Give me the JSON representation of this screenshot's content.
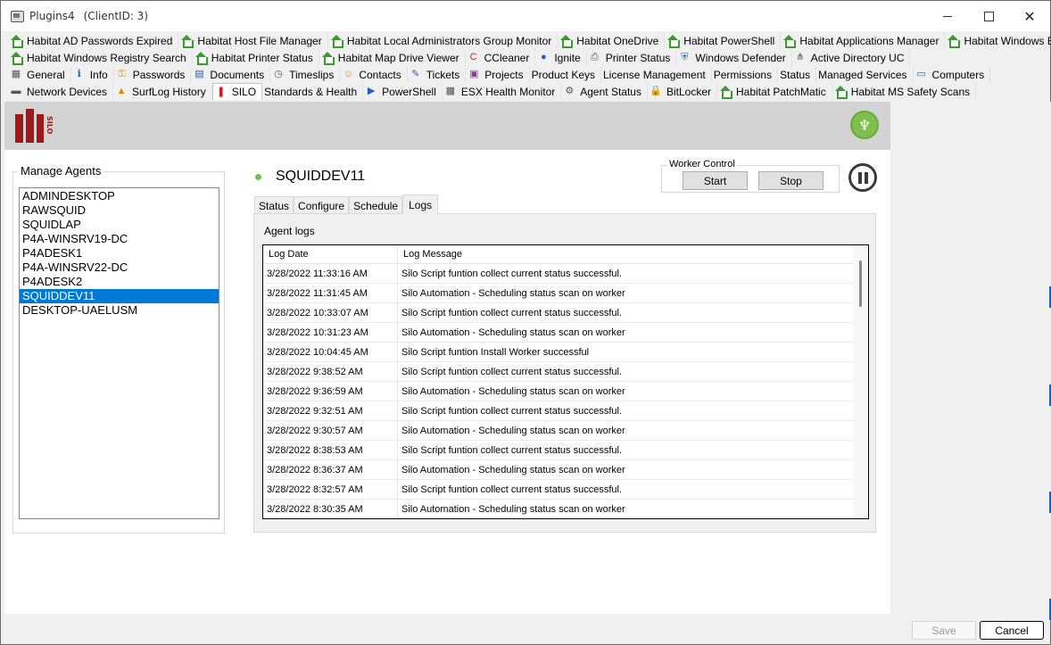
{
  "window": {
    "title": "Plugins4",
    "client": "(ClientID: 3)",
    "close_glyph": "✕"
  },
  "tabs": {
    "rows": [
      [
        {
          "label": "Habitat AD Passwords Expired",
          "icon": "house-icon"
        },
        {
          "label": "Habitat Host File Manager",
          "icon": "house-icon"
        },
        {
          "label": "Habitat Local Administrators Group Monitor",
          "icon": "house-icon"
        },
        {
          "label": "Habitat OneDrive",
          "icon": "house-icon"
        },
        {
          "label": "Habitat PowerShell",
          "icon": "house-icon"
        },
        {
          "label": "Habitat Applications Manager",
          "icon": "house-icon"
        },
        {
          "label": "Habitat Windows Backup",
          "icon": "house-icon"
        }
      ],
      [
        {
          "label": "Habitat Windows Registry Search",
          "icon": "house-icon"
        },
        {
          "label": "Habitat Printer Status",
          "icon": "house-icon"
        },
        {
          "label": "Habitat Map Drive Viewer",
          "icon": "house-icon"
        },
        {
          "label": "CCleaner",
          "icon": "ccleaner-icon"
        },
        {
          "label": "Ignite",
          "icon": "ignite-icon"
        },
        {
          "label": "Printer Status",
          "icon": "printer-icon"
        },
        {
          "label": "Windows Defender",
          "icon": "shield-icon"
        },
        {
          "label": "Active Directory UC",
          "icon": "network-tree-icon"
        }
      ],
      [
        {
          "label": "General",
          "icon": "grid-icon"
        },
        {
          "label": "Info",
          "icon": "info-icon"
        },
        {
          "label": "Passwords",
          "icon": "key-icon"
        },
        {
          "label": "Documents",
          "icon": "document-icon"
        },
        {
          "label": "Timeslips",
          "icon": "clock-icon"
        },
        {
          "label": "Contacts",
          "icon": "contacts-icon"
        },
        {
          "label": "Tickets",
          "icon": "ticket-icon"
        },
        {
          "label": "Projects",
          "icon": "projects-icon"
        },
        {
          "label": "Product Keys",
          "icon": ""
        },
        {
          "label": "License Management",
          "icon": ""
        },
        {
          "label": "Permissions",
          "icon": ""
        },
        {
          "label": "Status",
          "icon": ""
        },
        {
          "label": "Managed Services",
          "icon": ""
        },
        {
          "label": "Computers",
          "icon": "computers-icon"
        }
      ],
      [
        {
          "label": "Network Devices",
          "icon": "network-device-icon"
        },
        {
          "label": "SurfLog History",
          "icon": "cone-icon"
        },
        {
          "label": "SILO",
          "icon": "silo-icon"
        },
        {
          "label": "Standards & Health",
          "icon": ""
        },
        {
          "label": "PowerShell",
          "icon": "powershell-icon"
        },
        {
          "label": "ESX Health Monitor",
          "icon": "esx-icon"
        },
        {
          "label": "Agent Status",
          "icon": "gear-icon"
        },
        {
          "label": "BitLocker",
          "icon": "lock-icon"
        },
        {
          "label": "Habitat PatchMatic",
          "icon": "house-icon"
        },
        {
          "label": "Habitat MS Safety Scans",
          "icon": "house-icon"
        }
      ]
    ],
    "active": "SILO"
  },
  "banner": {
    "logo_text": "SILO"
  },
  "agents": {
    "legend": "Manage Agents",
    "items": [
      "ADMINDESKTOP",
      "RAWSQUID",
      "SQUIDLAP",
      "P4A-WINSRV19-DC",
      "P4ADESK1",
      "P4A-WINSRV22-DC",
      "P4ADESK2",
      "SQUIDDEV11",
      "DESKTOP-UAELUSM"
    ],
    "selected": "SQUIDDEV11"
  },
  "agent_detail": {
    "name": "SQUIDDEV11",
    "status_color": "#6cc04a"
  },
  "worker_control": {
    "legend": "Worker Control",
    "start_label": "Start",
    "stop_label": "Stop"
  },
  "subtabs": {
    "items": [
      "Status",
      "Configure",
      "Schedule",
      "Logs"
    ],
    "active": "Logs"
  },
  "logs": {
    "title": "Agent logs",
    "columns": [
      "Log Date",
      "Log Message"
    ],
    "rows": [
      [
        "3/28/2022 11:33:16 AM",
        "Silo Script funtion collect current status successful."
      ],
      [
        "3/28/2022 11:31:45 AM",
        "Silo Automation - Scheduling status scan on worker"
      ],
      [
        "3/28/2022 10:33:07 AM",
        "Silo Script funtion collect current status successful."
      ],
      [
        "3/28/2022 10:31:23 AM",
        "Silo Automation - Scheduling status scan on worker"
      ],
      [
        "3/28/2022 10:04:45 AM",
        "Silo Script funtion Install Worker successful"
      ],
      [
        "3/28/2022 9:38:52 AM",
        "Silo Script funtion collect current status successful."
      ],
      [
        "3/28/2022 9:36:59 AM",
        "Silo Automation - Scheduling status scan on worker"
      ],
      [
        "3/28/2022 9:32:51 AM",
        "Silo Script funtion collect current status successful."
      ],
      [
        "3/28/2022 9:30:57 AM",
        "Silo Automation - Scheduling status scan on worker"
      ],
      [
        "3/28/2022 8:38:53 AM",
        "Silo Script funtion collect current status successful."
      ],
      [
        "3/28/2022 8:36:37 AM",
        "Silo Automation - Scheduling status scan on worker"
      ],
      [
        "3/28/2022 8:32:57 AM",
        "Silo Script funtion collect current status successful."
      ],
      [
        "3/28/2022 8:30:35 AM",
        "Silo Automation - Scheduling status scan on worker"
      ]
    ]
  },
  "footer": {
    "save_label": "Save",
    "cancel_label": "Cancel"
  },
  "colors": {
    "selection": "#0078d7",
    "habitat_green": "#3a9a2e",
    "silo_red": "#a01818"
  }
}
